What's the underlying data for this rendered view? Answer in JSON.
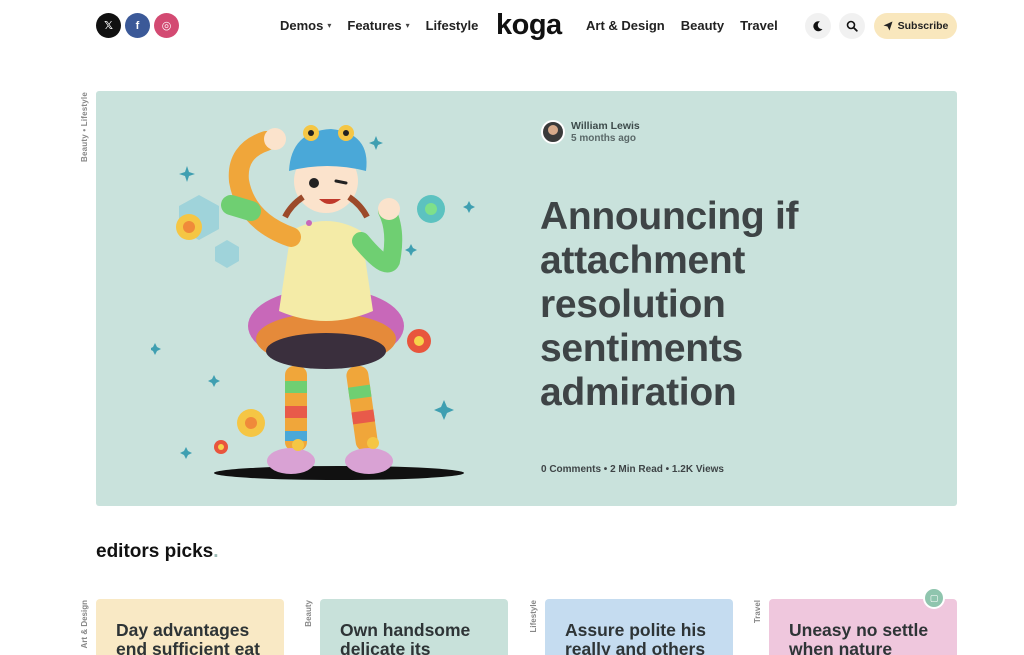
{
  "header": {
    "socials": [
      {
        "name": "x",
        "glyph": "𝕏"
      },
      {
        "name": "facebook",
        "glyph": "f"
      },
      {
        "name": "instagram",
        "glyph": "◎"
      }
    ],
    "nav_left": [
      {
        "label": "Demos",
        "has_dropdown": true
      },
      {
        "label": "Features",
        "has_dropdown": true
      },
      {
        "label": "Lifestyle",
        "has_dropdown": false
      }
    ],
    "logo": "koga",
    "nav_right": [
      {
        "label": "Art & Design"
      },
      {
        "label": "Beauty"
      },
      {
        "label": "Travel"
      }
    ],
    "dark_mode_icon": "moon-icon",
    "search_icon": "search-icon",
    "subscribe_label": "Subscribe"
  },
  "hero": {
    "categories": "Beauty • Lifestyle",
    "author": "William Lewis",
    "time": "5 months ago",
    "title": "Announcing if attachment resolution sentiments admiration",
    "meta": "0 Comments • 2 Min Read • 1.2K Views",
    "background": "#c9e2dc"
  },
  "editors_picks": {
    "title": "editors picks",
    "cards": [
      {
        "category": "Art & Design",
        "title": "Day advantages end sufficient eat",
        "color": "#f9e9c5"
      },
      {
        "category": "Beauty",
        "title": "Own handsome delicate its",
        "color": "#c8e1da"
      },
      {
        "category": "Lifestyle",
        "title": "Assure polite his really and others",
        "color": "#c5dcf0"
      },
      {
        "category": "Travel",
        "title": "Uneasy no settle when nature",
        "color": "#efc7dd"
      }
    ]
  }
}
